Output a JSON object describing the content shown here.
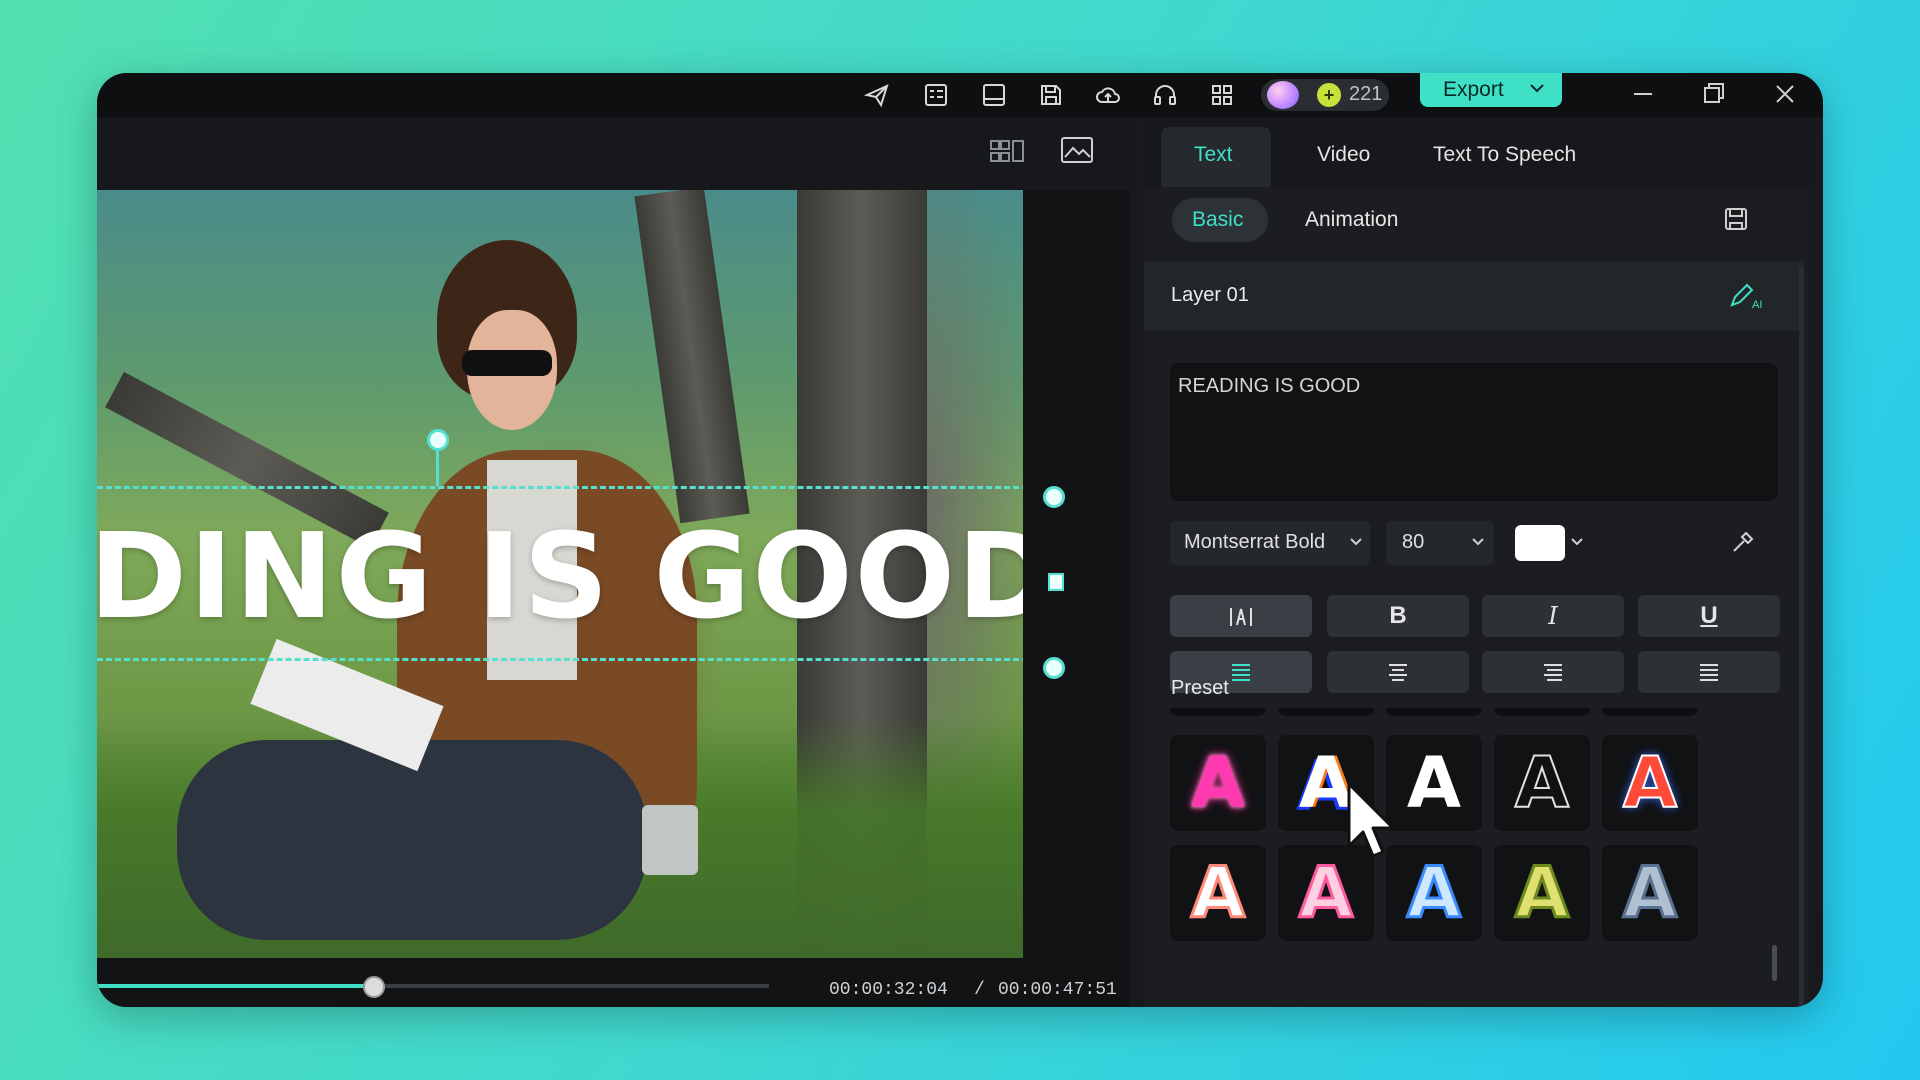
{
  "titlebar": {
    "icons": [
      "send-icon",
      "tasks-icon",
      "layout-icon",
      "save-icon",
      "cloud-upload-icon",
      "headset-icon",
      "apps-grid-icon"
    ],
    "credits": "221",
    "export_label": "Export"
  },
  "preview": {
    "overlay_text": "DING IS GOOD",
    "current_time": "00:00:32:04",
    "separator": "/",
    "total_time": "00:00:47:51",
    "progress": 0.41
  },
  "panel": {
    "tabs": [
      {
        "label": "Text",
        "active": true
      },
      {
        "label": "Video",
        "active": false
      },
      {
        "label": "Text To Speech",
        "active": false
      }
    ],
    "subtabs": [
      {
        "label": "Basic",
        "active": true
      },
      {
        "label": "Animation",
        "active": false
      }
    ],
    "layer_label": "Layer 01",
    "text_value": "READING IS GOOD",
    "font": "Montserrat Bold",
    "font_size": "80",
    "color": "#ffffff",
    "format_buttons": {
      "spacing": "spacing-icon",
      "bold": "B",
      "italic": "I",
      "underline": "U"
    },
    "align_buttons": [
      "align-left-icon",
      "align-center-icon",
      "align-right-icon",
      "align-justify-icon"
    ],
    "preset_label": "Preset",
    "presets": [
      {
        "glyph": "A",
        "name": "neon-pink"
      },
      {
        "glyph": "A",
        "name": "white-orange-blue"
      },
      {
        "glyph": "A",
        "name": "white-plain"
      },
      {
        "glyph": "A",
        "name": "black-outline"
      },
      {
        "glyph": "A",
        "name": "red-blue-glow"
      },
      {
        "glyph": "A",
        "name": "peach-outline"
      },
      {
        "glyph": "A",
        "name": "pink-outline"
      },
      {
        "glyph": "A",
        "name": "blue-outline"
      },
      {
        "glyph": "A",
        "name": "olive-outline"
      },
      {
        "glyph": "A",
        "name": "steel-outline"
      }
    ]
  },
  "colors": {
    "accent": "#3ee0c6",
    "window_bg": "#17191c",
    "panel_bg": "#1b1d20"
  }
}
